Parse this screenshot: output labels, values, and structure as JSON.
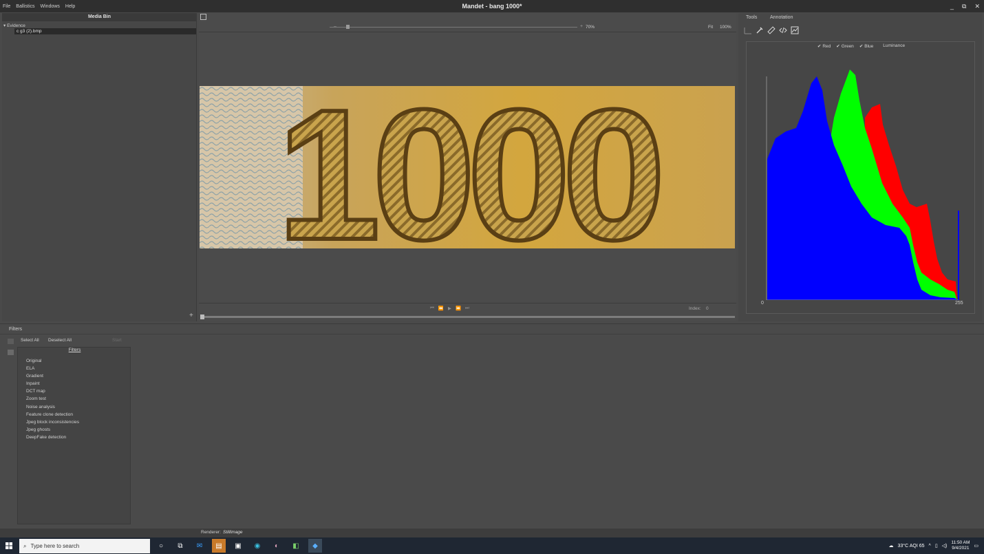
{
  "menu": [
    "File",
    "Ballistics",
    "Windows",
    "Help"
  ],
  "app_title": "Mandet - bang 1000*",
  "window_buttons": {
    "minimize": "_",
    "restore": "⧉",
    "close": "✕"
  },
  "media_bin": {
    "title": "Media Bin",
    "tree_root": "Evidence",
    "file": "c g3 (2).bmp",
    "add": "+"
  },
  "viewer": {
    "zoom_minus": "–",
    "zoom_plus": "+",
    "zoom_value": "70%",
    "fit_label": "Fit",
    "actual_label": "100%",
    "zoom_fraction": 0.07,
    "image_text": "1000",
    "player": [
      "⏮",
      "⏪",
      "▶",
      "⏩",
      "⏭"
    ],
    "index_label": "Index:",
    "index_value": "0"
  },
  "tools_panel": {
    "tabs": [
      "Tools",
      "Annotation"
    ],
    "tool_icons": [
      "histogram-icon",
      "eyedropper-icon",
      "ruler-icon",
      "code-icon",
      "image-chart-icon"
    ],
    "channels": [
      {
        "label": "Red",
        "checked": true
      },
      {
        "label": "Green",
        "checked": true
      },
      {
        "label": "Blue",
        "checked": true
      },
      {
        "label": "Luminance",
        "checked": false
      }
    ],
    "hist_min": "0",
    "hist_max": "255",
    "colors": {
      "red": "#ff0000",
      "green": "#00ff00",
      "blue": "#0000ff"
    }
  },
  "bottom": {
    "tab_filters": "Filters",
    "select_all": "Select All",
    "deselect_all": "Deselect All",
    "start": "Start",
    "list_header": "Filters",
    "filters": [
      "Original",
      "ELA",
      "Gradient",
      "Inpaint",
      "DCT map",
      "Zoom test",
      "Noise analysis",
      "Feature clone detection",
      "Jpeg block inconsistencies",
      "Jpeg ghosts",
      "DeepFake detection"
    ]
  },
  "status": {
    "renderer_label": "Renderer:",
    "renderer_value": "StillImage"
  },
  "taskbar": {
    "search_placeholder": "Type here to search",
    "weather": "33°C  AQI 65",
    "time": "11:50 AM",
    "date": "9/4/2021"
  }
}
